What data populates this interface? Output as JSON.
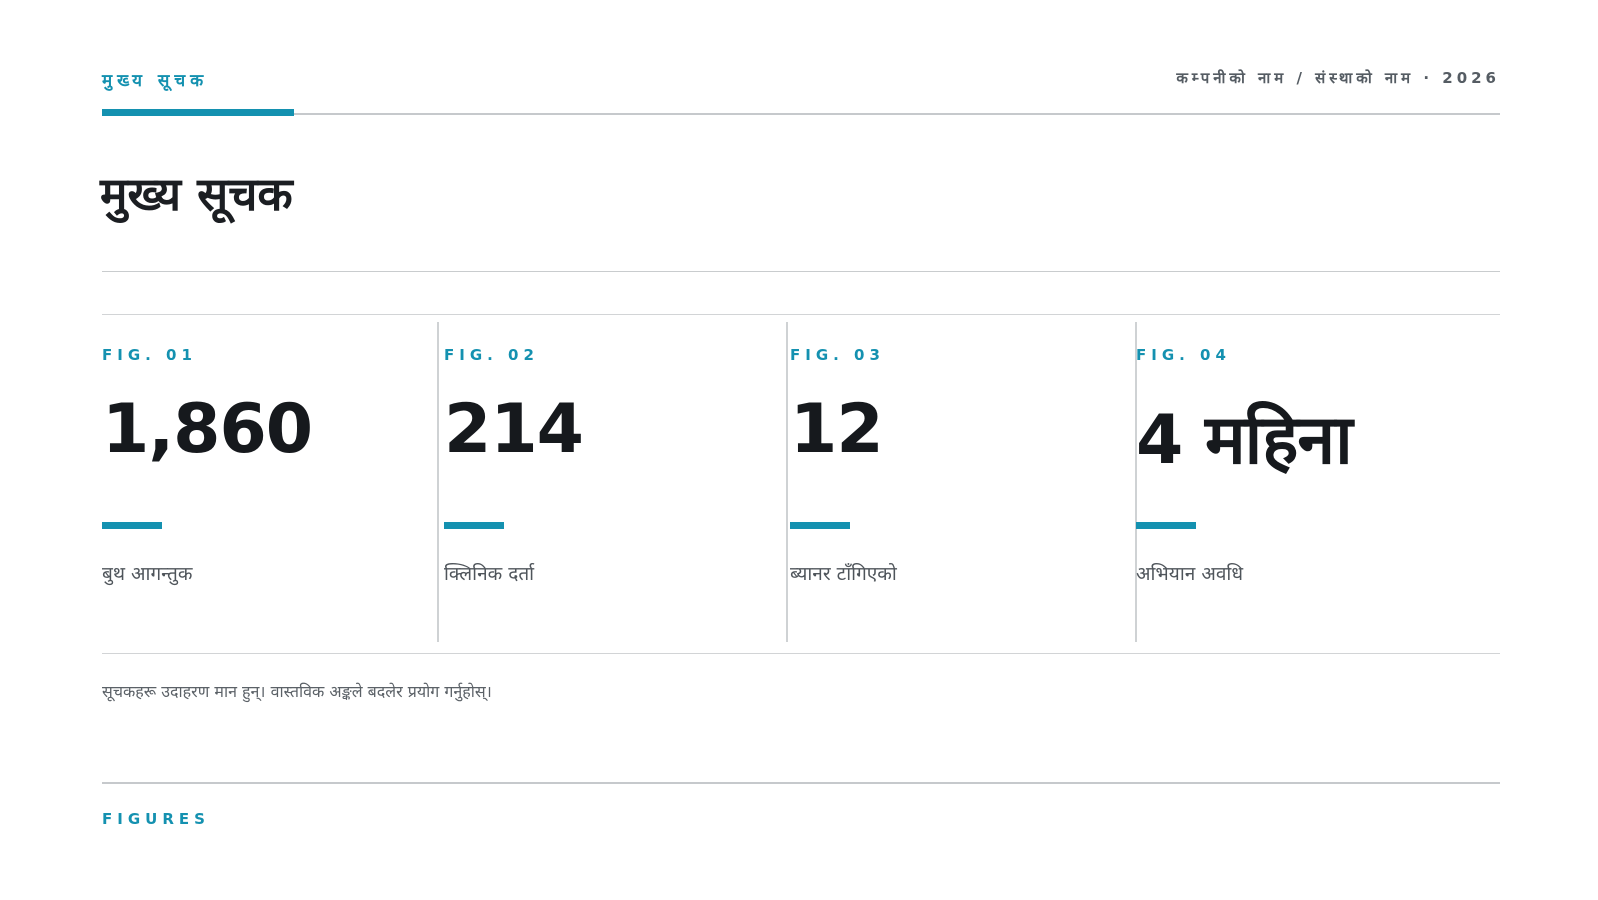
{
  "header": {
    "kicker": "मुख्य सूचक",
    "company": "कम्पनीको नाम / संस्थाको नाम · 2026"
  },
  "title": "मुख्य सूचक",
  "metrics": [
    {
      "fig": "FIG. 01",
      "value": "1,860",
      "label": "बुथ आगन्तुक"
    },
    {
      "fig": "FIG. 02",
      "value": "214",
      "label": "क्लिनिक दर्ता"
    },
    {
      "fig": "FIG. 03",
      "value": "12",
      "label": "ब्यानर टाँगिएको"
    },
    {
      "fig": "FIG. 04",
      "value": "4 महिना",
      "label": "अभियान अवधि"
    }
  ],
  "note": "सूचकहरू उदाहरण मान हुन्। वास्तविक अङ्कले बदलेर प्रयोग गर्नुहोस्।",
  "footer": {
    "label": "FIGURES"
  },
  "colors": {
    "accent": "#1491b0",
    "text": "#1b1e22",
    "muted": "#4f555b"
  }
}
